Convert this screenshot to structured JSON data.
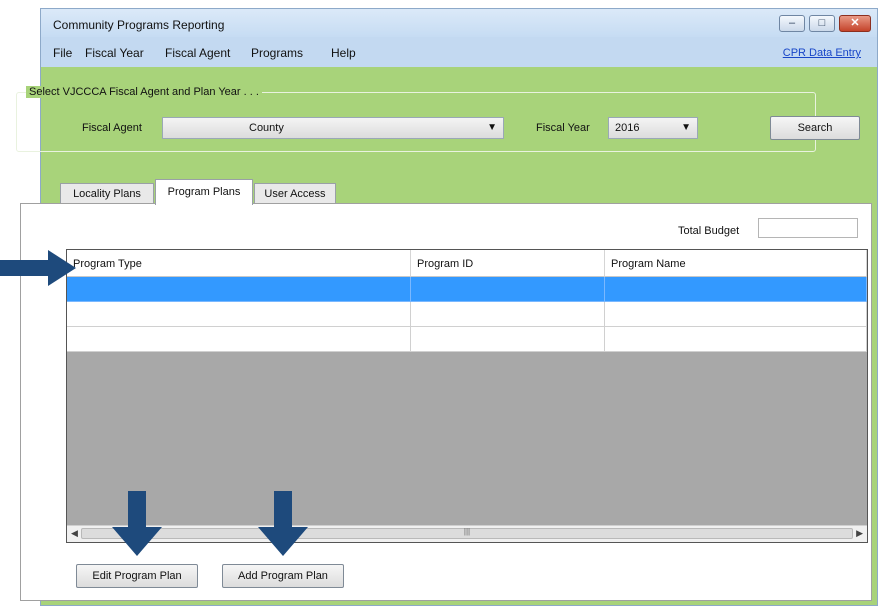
{
  "window": {
    "title": "Community Programs Reporting",
    "controls": {
      "minimize": "–",
      "maximize": "□",
      "close": "✕"
    }
  },
  "menubar": {
    "items": [
      "File",
      "Fiscal Year",
      "Fiscal Agent",
      "Programs",
      "Help"
    ],
    "link": "CPR Data Entry"
  },
  "selection": {
    "legend": "Select VJCCCA Fiscal Agent and Plan Year . . .",
    "fiscal_agent_label": "Fiscal Agent",
    "fiscal_agent_value": "County",
    "fiscal_year_label": "Fiscal Year",
    "fiscal_year_value": "2016",
    "search_label": "Search"
  },
  "tabs": [
    "Locality Plans",
    "Program Plans",
    "User Access"
  ],
  "active_tab": "Program Plans",
  "program_plans": {
    "total_budget_label": "Total Budget",
    "total_budget_value": "",
    "columns": [
      "Program Type",
      "Program ID",
      "Program Name"
    ],
    "rows": [
      [
        "",
        "",
        ""
      ],
      [
        "",
        "",
        ""
      ],
      [
        "",
        "",
        ""
      ]
    ],
    "edit_button": "Edit Program Plan",
    "add_button": "Add Program Plan"
  },
  "colors": {
    "selected_row": "#3399ff",
    "panel_green": "#a8d37a",
    "annotation_arrow": "#1e4a7c"
  }
}
